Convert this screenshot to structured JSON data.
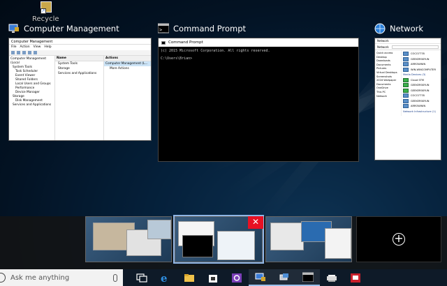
{
  "desktop": {
    "icon_label": "Recycle"
  },
  "windows": [
    {
      "title": "Computer Management",
      "content": {
        "window_title": "Computer Management",
        "menu": [
          "File",
          "Action",
          "View",
          "Help"
        ],
        "tree": [
          "Computer Management (Local",
          "System Tools",
          "Task Scheduler",
          "Event Viewer",
          "Shared Folders",
          "Local Users and Groups",
          "Performance",
          "Device Manager",
          "Storage",
          "Disk Management",
          "Services and Applications"
        ],
        "list_header": "Name",
        "list": [
          "System Tools",
          "Storage",
          "Services and Applications"
        ],
        "actions_header": "Actions",
        "actions_selected": "Computer Management (L...",
        "actions_more": "More Actions"
      }
    },
    {
      "title": "Command Prompt",
      "content": {
        "window_title": "Command Prompt",
        "line1": "(c) 2015 Microsoft Corporation. All rights reserved.",
        "line2": "C:\\Users\\Brian>"
      }
    },
    {
      "title": "Network",
      "content": {
        "window_title": "Network",
        "address": "Network",
        "sidebar": [
          "Quick access",
          "Desktop",
          "Downloads",
          "Documents",
          "Pictures",
          "Virtual Desktops",
          "Screenshots",
          "2016 Wallpaper",
          "Documents",
          "OneDrive",
          "This PC",
          "Network"
        ],
        "computers": [
          "COCO7778",
          "GEEKERSKYUN",
          "ARROWWIN",
          "WIN-WINCOMPUTER"
        ],
        "section_media": "Media Devices (3)",
        "media": [
          "Cloud STM",
          "GEEKERSKYUN",
          "GEEKERSKYUN"
        ],
        "computers2": [
          "COCO7778",
          "GEEKERSKYUN",
          "ARROWWIN"
        ],
        "section_infra": "Network Infrastructure (1)"
      }
    }
  ],
  "taskbar": {
    "search_placeholder": "Ask me anything",
    "icons": [
      "task-view-icon",
      "edge-icon",
      "file-explorer-icon",
      "store-icon",
      "settings-icon",
      "computer-management-icon",
      "network-icon",
      "command-prompt-icon",
      "scanner-icon",
      "news-icon"
    ]
  },
  "virtual_desktops": {
    "count": 4,
    "add_symbol": "+"
  },
  "colors": {
    "accent": "#8fb6e6",
    "close_red": "#e81123",
    "taskbar": "#0e1a28"
  }
}
